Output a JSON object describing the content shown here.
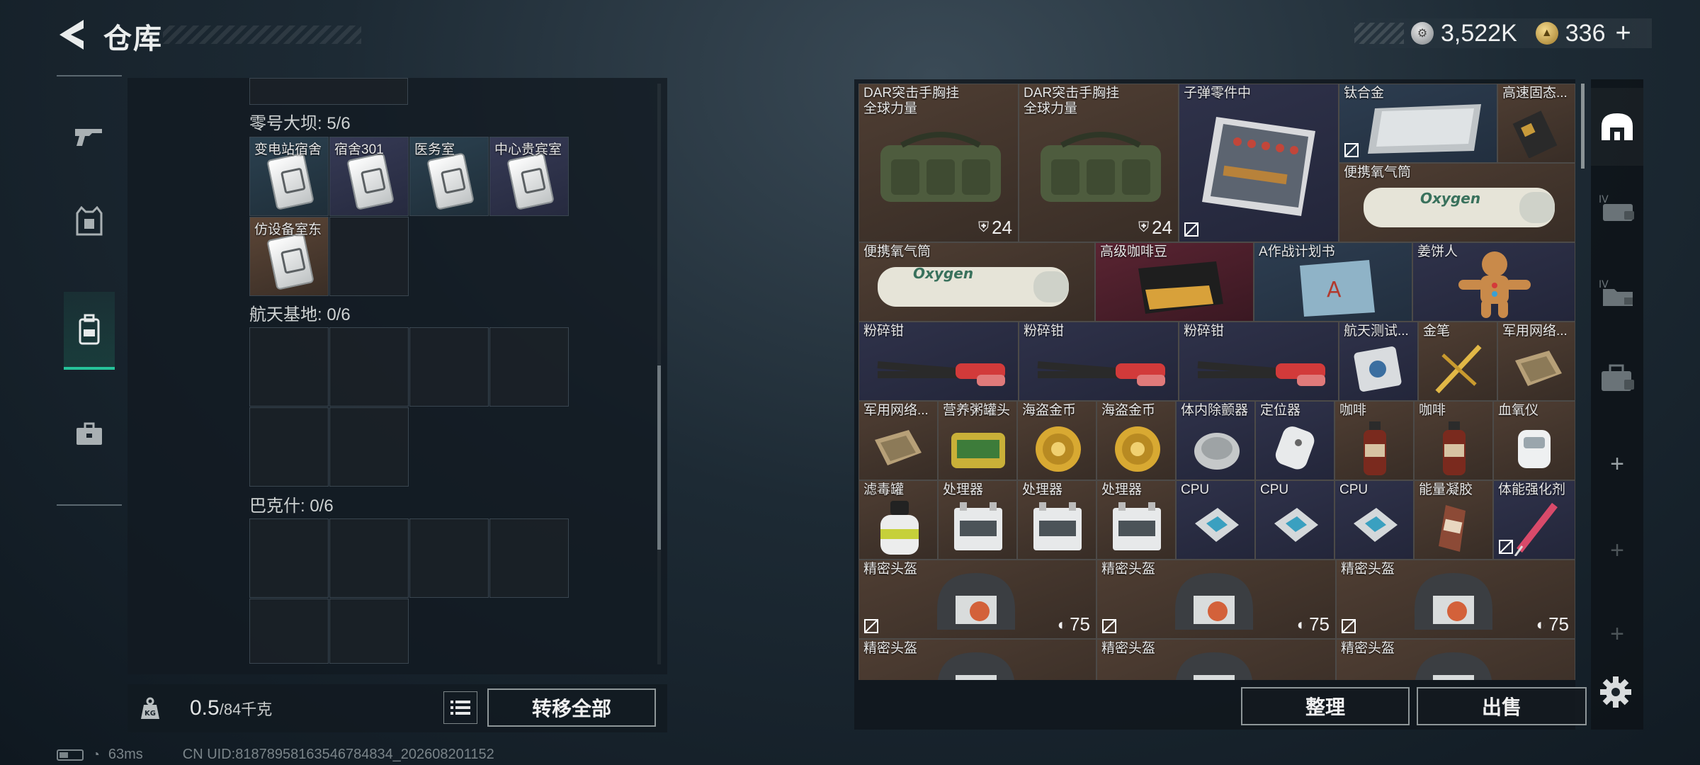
{
  "header": {
    "title": "仓库"
  },
  "currency": {
    "silver_value": "3,522K",
    "gold_value": "336",
    "add_label": "+"
  },
  "left_rail": [
    "gun-icon",
    "armor-vest-icon",
    "backpack-icon",
    "briefcase-icon"
  ],
  "keycards": {
    "sections": [
      {
        "label": "零号大坝: 5/6",
        "cards": [
          "变电站宿舍",
          "宿舍301",
          "医务室",
          "中心贵宾室",
          "仿设备室东"
        ]
      },
      {
        "label": "航天基地: 0/6"
      },
      {
        "label": "巴克什: 0/6"
      }
    ]
  },
  "footer": {
    "weight_current": "0.5",
    "weight_max": "/84千克",
    "kg_badge": "KG",
    "transfer_label": "转移全部"
  },
  "inventory": {
    "items": [
      {
        "label": "DAR突击手胸挂\n全球力量",
        "count": "24"
      },
      {
        "label": "DAR突击手胸挂\n全球力量",
        "count": "24"
      },
      {
        "label": "子弹零件中"
      },
      {
        "label": "钛合金"
      },
      {
        "label": "高速固态..."
      },
      {
        "label": "便携氧气筒"
      },
      {
        "label": "便携氧气筒"
      },
      {
        "label": "高级咖啡豆"
      },
      {
        "label": "A作战计划书"
      },
      {
        "label": "姜饼人"
      },
      {
        "label": "粉碎钳"
      },
      {
        "label": "粉碎钳"
      },
      {
        "label": "粉碎钳"
      },
      {
        "label": "航天测试..."
      },
      {
        "label": "金笔"
      },
      {
        "label": "军用网络..."
      },
      {
        "label": "军用网络..."
      },
      {
        "label": "营养粥罐头"
      },
      {
        "label": "海盗金币"
      },
      {
        "label": "海盗金币"
      },
      {
        "label": "体内除颤器"
      },
      {
        "label": "定位器"
      },
      {
        "label": "咖啡"
      },
      {
        "label": "咖啡"
      },
      {
        "label": "血氧仪"
      },
      {
        "label": "滤毒罐"
      },
      {
        "label": "处理器"
      },
      {
        "label": "处理器"
      },
      {
        "label": "处理器"
      },
      {
        "label": "CPU"
      },
      {
        "label": "CPU"
      },
      {
        "label": "CPU"
      },
      {
        "label": "能量凝胶"
      },
      {
        "label": "体能强化剂"
      },
      {
        "label": "精密头盔",
        "count": "75"
      },
      {
        "label": "精密头盔",
        "count": "75"
      },
      {
        "label": "精密头盔",
        "count": "75"
      },
      {
        "label": "精密头盔"
      },
      {
        "label": "精密头盔"
      },
      {
        "label": "精密头盔"
      }
    ]
  },
  "right_rail": [
    "safehouse-icon",
    "case-iv-icon",
    "folder-iv-icon",
    "case-locked-icon",
    "add-icon",
    "add-icon",
    "add-icon"
  ],
  "actions": {
    "sort_label": "整理",
    "sell_label": "出售"
  },
  "status": {
    "ping": "63ms",
    "uid": "CN UID:81878958163546784834_202608201152"
  },
  "colors": {
    "accent": "#26c39a",
    "brown_cell": "#4f3e33",
    "purple_cell": "#2f324a",
    "red_cell": "#5a2432",
    "blue_cell": "#2d3d50"
  }
}
